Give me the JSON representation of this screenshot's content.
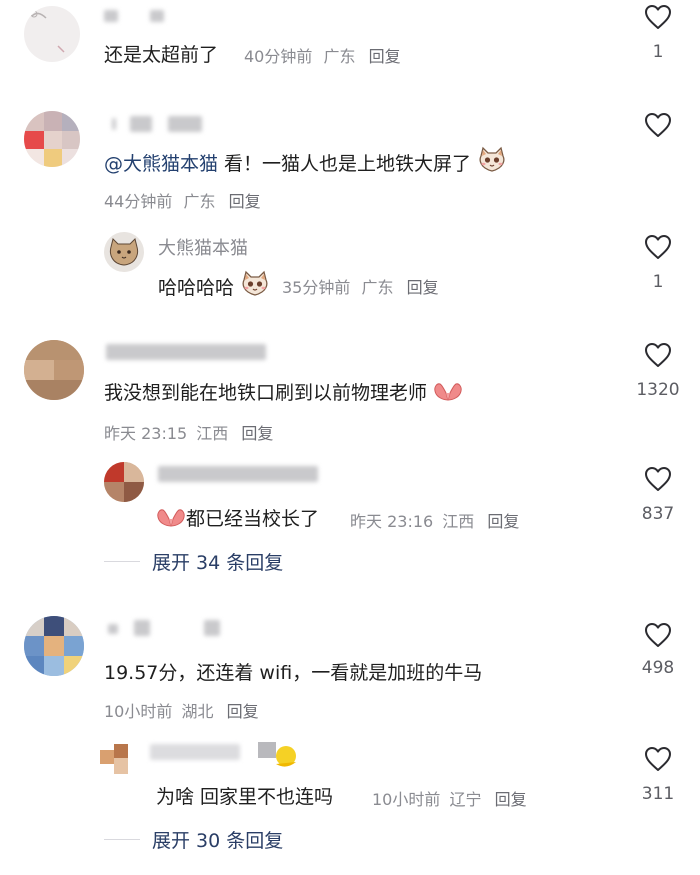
{
  "comments": [
    {
      "text": "还是太超前了",
      "time": "40分钟前",
      "location": "广东",
      "reply_label": "回复",
      "likes": "1"
    },
    {
      "mention": "@大熊猫本猫",
      "text": " 看！一猫人也是上地铁大屏了",
      "time": "44分钟前",
      "location": "广东",
      "reply_label": "回复",
      "reply": {
        "name": "大熊猫本猫",
        "text": "哈哈哈哈",
        "time": "35分钟前",
        "location": "广东",
        "reply_label": "回复",
        "likes": "1"
      }
    },
    {
      "text": "我没想到能在地铁口刷到以前物理老师",
      "time": "昨天 23:15",
      "location": "江西",
      "reply_label": "回复",
      "likes": "1320",
      "reply": {
        "text": "都已经当校长了",
        "time": "昨天 23:16",
        "location": "江西",
        "reply_label": "回复",
        "likes": "837"
      },
      "expand_label": "展开 34 条回复"
    },
    {
      "text": "19.57分，还连着 wifi，一看就是加班的牛马",
      "time": "10小时前",
      "location": "湖北",
      "reply_label": "回复",
      "likes": "498",
      "reply": {
        "text": "为啥 回家里不也连吗",
        "time": "10小时前",
        "location": "辽宁",
        "reply_label": "回复",
        "likes": "311"
      },
      "expand_label": "展开 30 条回复"
    }
  ],
  "icons": {
    "like": "heart-outline-icon",
    "palms": "palms-together-emoji",
    "cat": "cat-emoji"
  },
  "colors": {
    "text": "#1f1f1f",
    "meta": "#8a8b91",
    "link": "#2a3e66"
  }
}
